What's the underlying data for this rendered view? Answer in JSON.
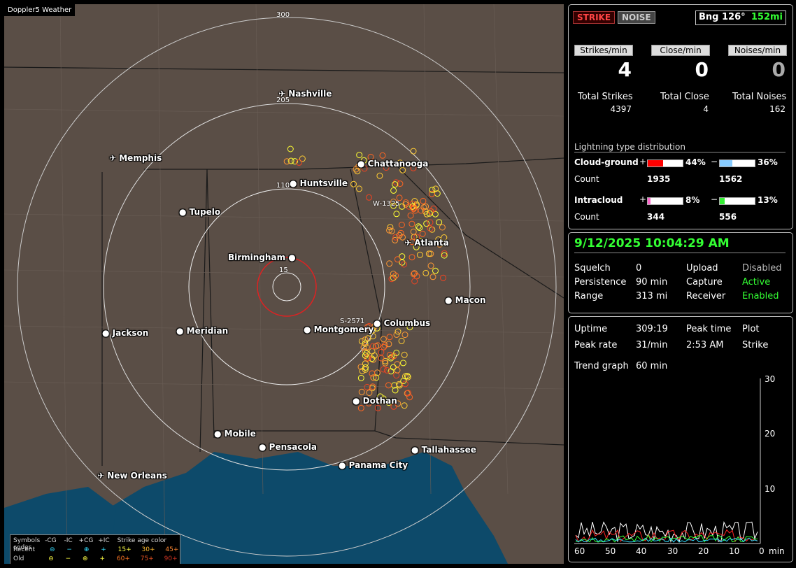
{
  "window_title": "Doppler5 Weather",
  "map": {
    "ring_labels": [
      "300",
      "205",
      "110",
      "15"
    ],
    "cities": [
      {
        "name": "Nashville",
        "airport": true
      },
      {
        "name": "Memphis",
        "airport": true
      },
      {
        "name": "Chattanooga",
        "airport": false
      },
      {
        "name": "Huntsville",
        "airport": false
      },
      {
        "name": "Tupelo",
        "airport": false
      },
      {
        "name": "Atlanta",
        "airport": true
      },
      {
        "name": "Birmingham",
        "airport": false
      },
      {
        "name": "Macon",
        "airport": false
      },
      {
        "name": "Columbus",
        "airport": false
      },
      {
        "name": "Jackson",
        "airport": false
      },
      {
        "name": "Meridian",
        "airport": false
      },
      {
        "name": "Montgomery",
        "airport": false
      },
      {
        "name": "Dothan",
        "airport": false
      },
      {
        "name": "Mobile",
        "airport": false
      },
      {
        "name": "Pensacola",
        "airport": false
      },
      {
        "name": "Tallahassee",
        "airport": false
      },
      {
        "name": "Panama City",
        "airport": false
      },
      {
        "name": "New Orleans",
        "airport": true
      }
    ],
    "markers": [
      "W-1325",
      "S-2571"
    ]
  },
  "legend": {
    "header": [
      "Symbols",
      "-CG",
      "-IC",
      "+CG",
      "+IC",
      "Strike age color codes"
    ],
    "recent_label": "Recent",
    "old_label": "Old",
    "recent_codes": [
      "15+",
      "30+",
      "45+"
    ],
    "old_codes": [
      "60+",
      "75+",
      "90+"
    ]
  },
  "status": {
    "strike_btn": "STRIKE",
    "noise_btn": "NOISE",
    "bearing": "Bng 126°",
    "distance": "152mi"
  },
  "counters": {
    "strikes_per_min_label": "Strikes/min",
    "close_per_min_label": "Close/min",
    "noises_per_min_label": "Noises/min",
    "strikes_per_min": "4",
    "close_per_min": "0",
    "noises_per_min": "0",
    "total_strikes_label": "Total Strikes",
    "total_close_label": "Total Close",
    "total_noises_label": "Total Noises",
    "total_strikes": "4397",
    "total_close": "4",
    "total_noises": "162"
  },
  "distribution": {
    "title": "Lightning type distribution",
    "cg_label": "Cloud-ground",
    "ic_label": "Intracloud",
    "count_label": "Count",
    "plus": "+",
    "minus": "−",
    "cg_pos_pct": "44%",
    "cg_neg_pct": "36%",
    "cg_pos_count": "1935",
    "cg_neg_count": "1562",
    "ic_pos_pct": "8%",
    "ic_neg_pct": "13%",
    "ic_pos_count": "344",
    "ic_neg_count": "556",
    "cg_pos_frac": 0.44,
    "cg_neg_frac": 0.36,
    "ic_pos_frac": 0.08,
    "ic_neg_frac": 0.13,
    "colors": {
      "cg_pos": "#ff0000",
      "cg_neg": "#88ccff",
      "ic_pos": "#ff66cc",
      "ic_neg": "#33ee33"
    }
  },
  "settings": {
    "datetime": "9/12/2025 10:04:29 AM",
    "squelch_label": "Squelch",
    "squelch": "0",
    "persistence_label": "Persistence",
    "persistence": "90 min",
    "range_label": "Range",
    "range": "313 mi",
    "upload_label": "Upload",
    "upload": "Disabled",
    "capture_label": "Capture",
    "capture": "Active",
    "receiver_label": "Receiver",
    "receiver": "Enabled"
  },
  "trend": {
    "uptime_label": "Uptime",
    "uptime": "309:19",
    "peak_time_label": "Peak time",
    "peak_time": "2:53 AM",
    "plot_label": "Plot",
    "peak_rate_label": "Peak rate",
    "peak_rate": "31/min",
    "plot_value": "Strike",
    "trend_graph_label": "Trend graph",
    "trend_graph_value": "60 min",
    "y_ticks": [
      "30",
      "20",
      "10"
    ],
    "x_ticks": [
      "60",
      "50",
      "40",
      "30",
      "20",
      "10",
      "0"
    ],
    "x_unit": "min"
  }
}
